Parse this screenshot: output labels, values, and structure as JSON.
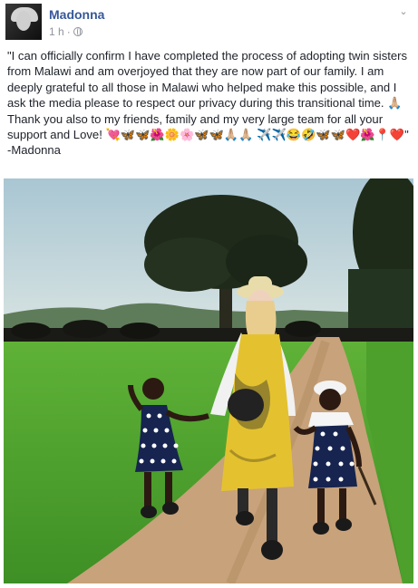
{
  "post": {
    "author": "Madonna",
    "timestamp": "1 h",
    "separator": "·",
    "privacy_icon": "globe-icon",
    "menu_icon": "chevron-down-icon",
    "text": "\"I can officially confirm I have completed the process of adopting twin sisters from Malawi and am overjoyed that they are now part of our family. I am deeply grateful to all those in Malawi who helped make this possible, and I ask the media please to respect our privacy during this transitional time. 🙏🏼 Thank you also to my friends, family and my very large team for all your support and Love! 💘🦋🦋🌺🌼🌸🦋🦋🙏🏼🙏🏼 ✈️✈️😂🤣🦋🦋❤️🌺📍❤️\" -Madonna"
  },
  "colors": {
    "link": "#365899",
    "meta": "#90949c",
    "text": "#1d2129"
  }
}
